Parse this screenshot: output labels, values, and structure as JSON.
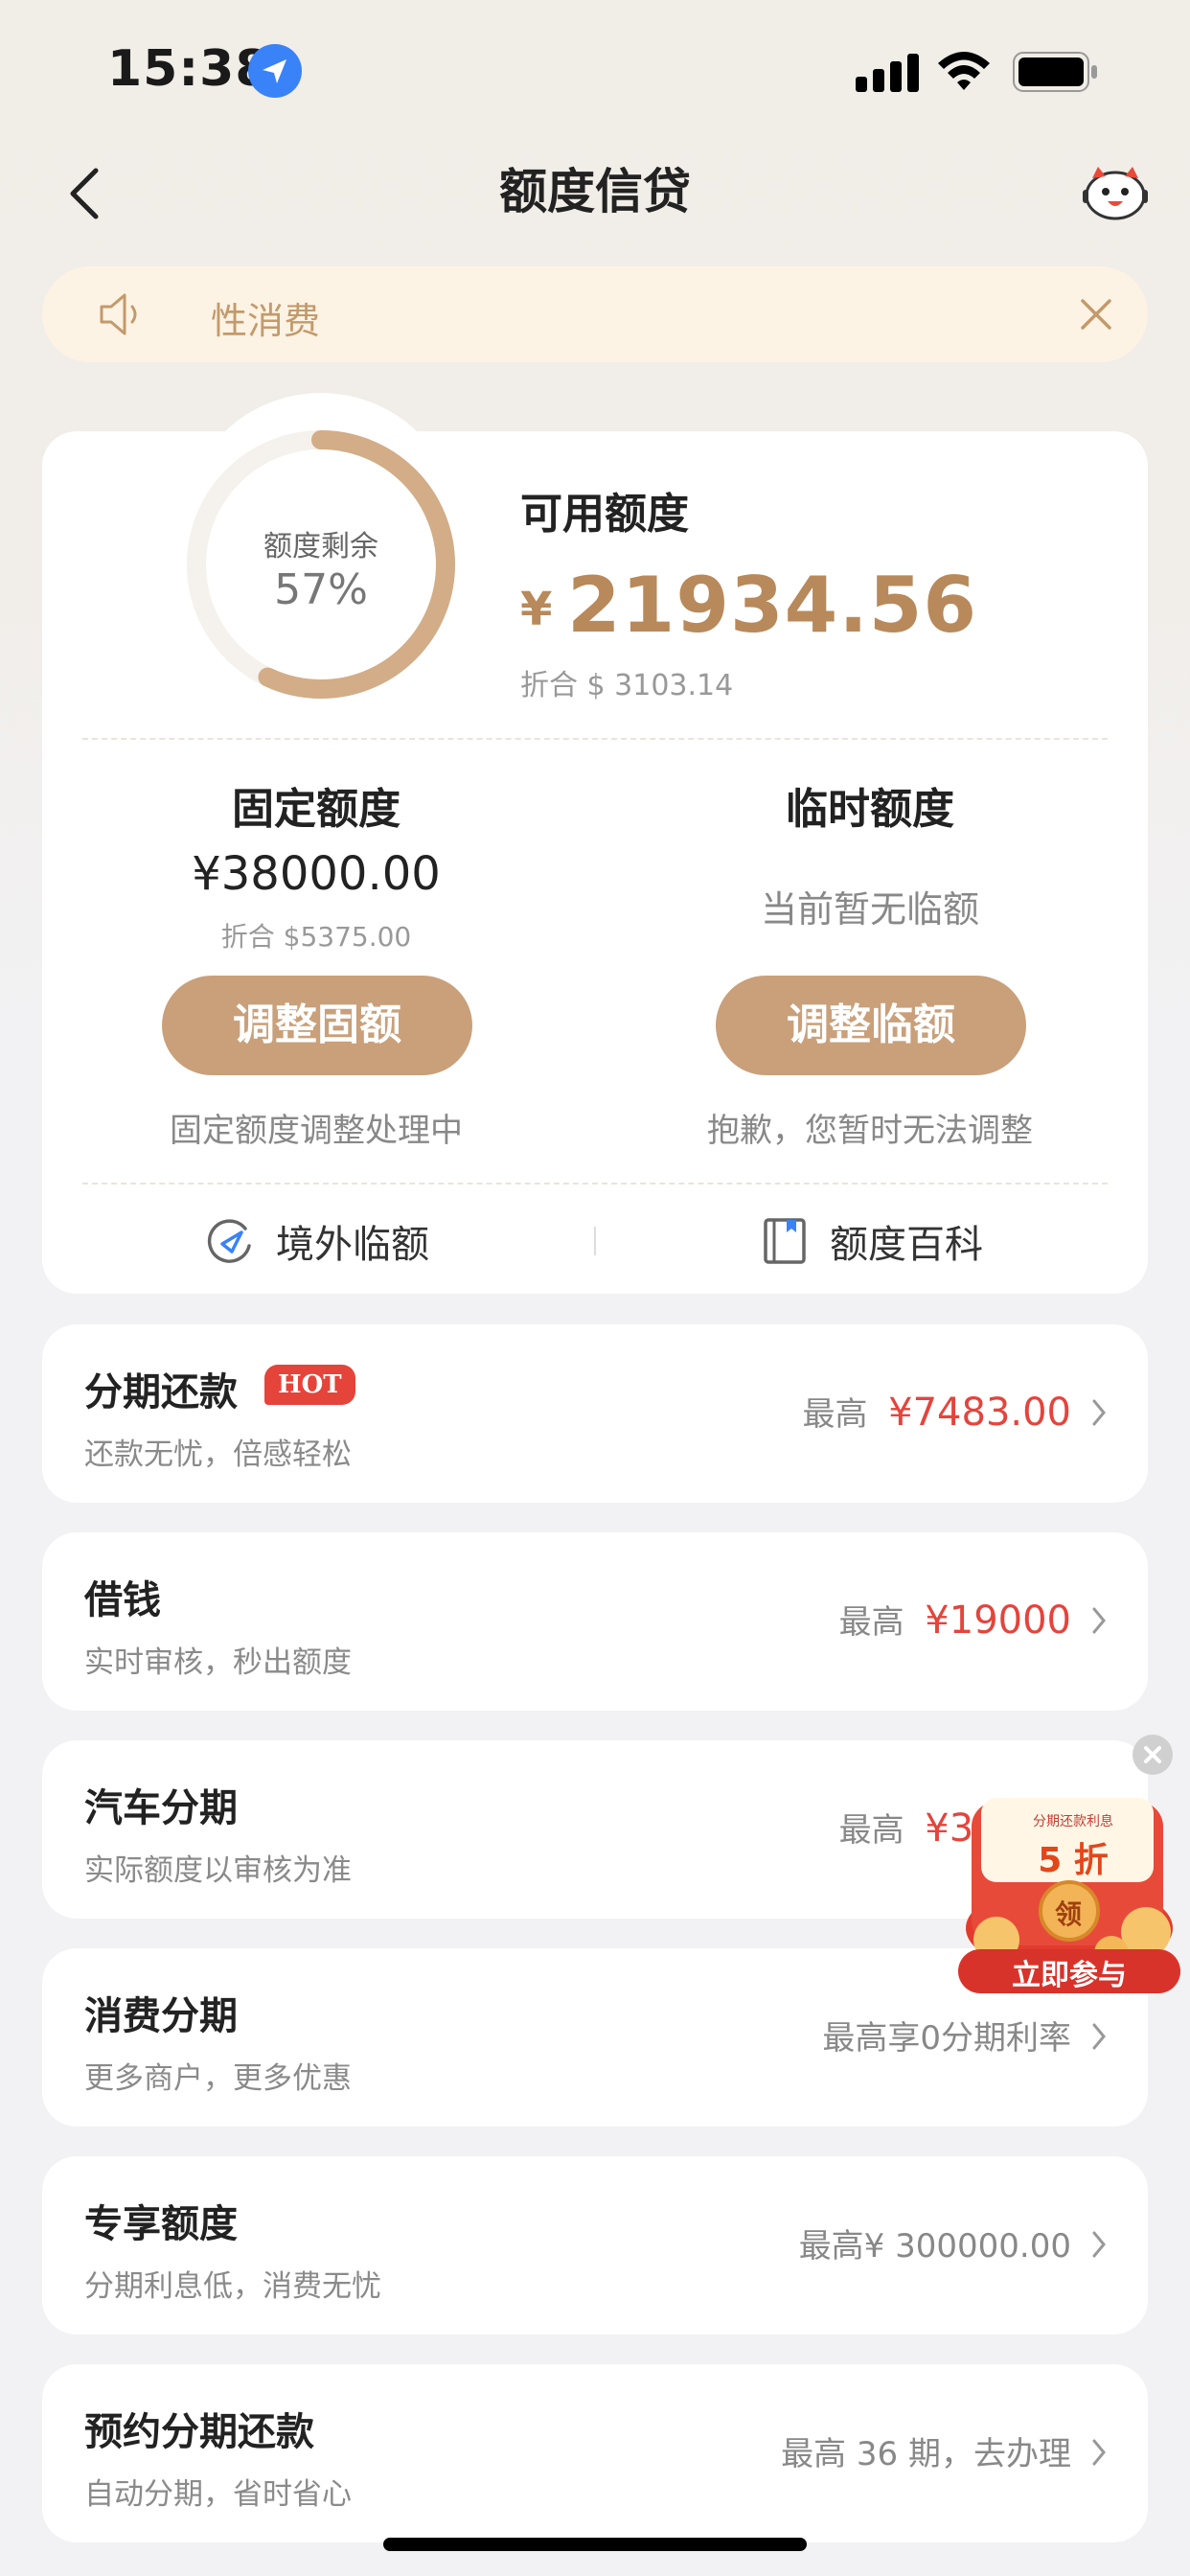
{
  "status_bar": {
    "time": "15:38"
  },
  "nav": {
    "title": "额度信贷"
  },
  "notice": {
    "text": "性消费"
  },
  "credit": {
    "ring_label": "额度剩余",
    "ring_percent_text": "57%",
    "remaining_fraction": 0.57,
    "available_label": "可用额度",
    "available_currency": "¥",
    "available_amount": "21934.56",
    "available_sub": "折合 $ 3103.14"
  },
  "fixed": {
    "title": "固定额度",
    "amount": "¥38000.00",
    "sub": "折合 $5375.00",
    "button": "调整固额",
    "note": "固定额度调整处理中"
  },
  "temp": {
    "title": "临时额度",
    "none_text": "当前暂无临额",
    "button": "调整临额",
    "note": "抱歉，您暂时无法调整"
  },
  "links": {
    "overseas": "境外临额",
    "wiki": "额度百科"
  },
  "rows": [
    {
      "title": "分期还款",
      "badge": "HOT",
      "sub": "还款无忧，倍感轻松",
      "prefix": "最高",
      "value": "¥7483.00"
    },
    {
      "title": "借钱",
      "sub": "实时审核，秒出额度",
      "prefix": "最高",
      "value": "¥19000"
    },
    {
      "title": "汽车分期",
      "sub": "实际额度以审核为准",
      "prefix": "最高",
      "value": "¥35000"
    },
    {
      "title": "消费分期",
      "sub": "更多商户，更多优惠",
      "right_text": "最高享0分期利率"
    },
    {
      "title": "专享额度",
      "sub": "分期利息低，消费无忧",
      "right_text": "最高¥ 300000.00"
    },
    {
      "title": "预约分期还款",
      "sub": "自动分期，省时省心",
      "right_text": "最高 36 期，去办理"
    }
  ],
  "promo": {
    "line1": "分期还款利息",
    "discount": "5 折",
    "seal": "领",
    "cta": "立即参与"
  },
  "colors": {
    "accent": "#c9a07a",
    "accent_text": "#b8895a",
    "red": "#e5443c",
    "notice_bg": "#fdf3e4"
  }
}
